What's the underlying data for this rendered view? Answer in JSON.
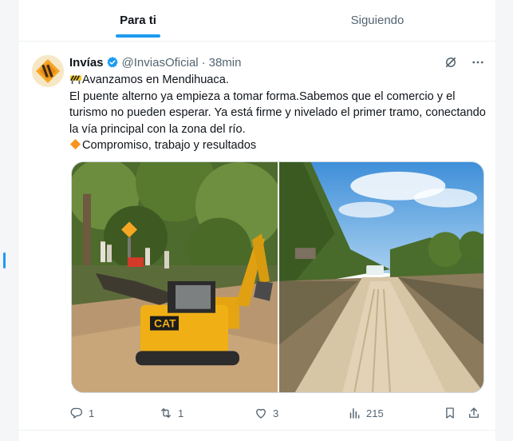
{
  "tabs": [
    {
      "label": "Para ti",
      "active": true
    },
    {
      "label": "Siguiendo",
      "active": false
    }
  ],
  "tweet": {
    "author_name": "Invías",
    "handle": "@InviasOficial",
    "separator": "·",
    "time": "38min",
    "line1": "Avanzamos en Mendihuaca.",
    "line1_icon": "construction-icon",
    "line2": "El puente alterno ya empieza a tomar forma.Sabemos que el comercio y el turismo no pueden esperar. Ya está firme y nivelado el primer tramo, conectando la vía principal con la zona del río.",
    "line3": "Compromiso, trabajo y resultados",
    "line3_icon": "orange-diamond-icon",
    "media": [
      {
        "description_icon": "excavator-photo",
        "badge_text": "CAT"
      },
      {
        "description_icon": "dirt-road-photo"
      }
    ],
    "stats": {
      "replies": "1",
      "retweets": "1",
      "likes": "3",
      "views": "215"
    }
  },
  "colors": {
    "accent": "#1d9bf0",
    "text_primary": "#0f1419",
    "text_secondary": "#536471",
    "verified": "#1d9bf0",
    "diamond": "#f7941d"
  }
}
